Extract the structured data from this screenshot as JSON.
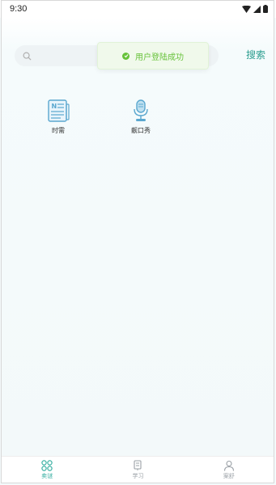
{
  "status_bar": {
    "time": "9:30"
  },
  "search": {
    "placeholder": "",
    "button_label": "搜索"
  },
  "toast": {
    "message": "用户登陆成功"
  },
  "grid": [
    {
      "label": "时需",
      "icon": "newspaper-icon"
    },
    {
      "label": "靓口秀",
      "icon": "microphone-icon"
    }
  ],
  "tabbar": {
    "tabs": [
      {
        "label": "卖谜",
        "icon": "grid-icon",
        "active": true
      },
      {
        "label": "学习",
        "icon": "book-icon",
        "active": false
      },
      {
        "label": "案舒",
        "icon": "user-icon",
        "active": false
      }
    ]
  },
  "colors": {
    "accent": "#2a9d8f",
    "toast_text": "#67c23a",
    "toast_bg": "#f0f9eb"
  }
}
